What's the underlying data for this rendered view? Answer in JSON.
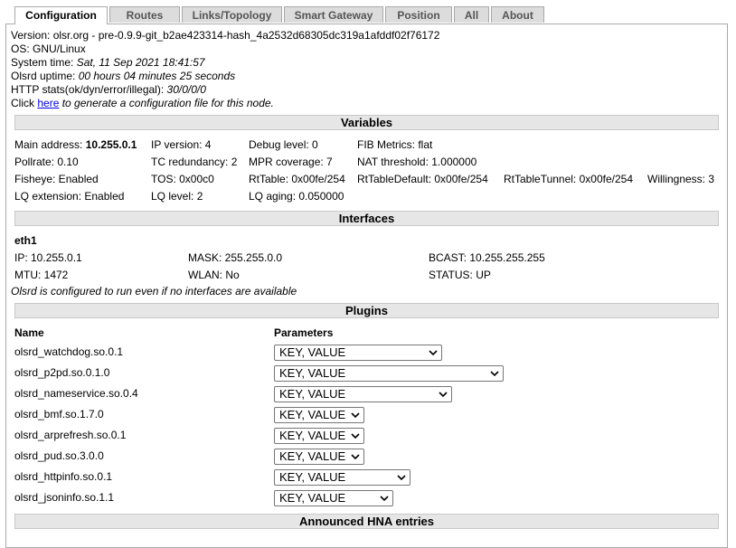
{
  "tabs": [
    {
      "label": "Configuration"
    },
    {
      "label": "Routes"
    },
    {
      "label": "Links/Topology"
    },
    {
      "label": "Smart Gateway"
    },
    {
      "label": "Position"
    },
    {
      "label": "All"
    },
    {
      "label": "About"
    }
  ],
  "info": {
    "version_label": "Version:",
    "version_value": "olsr.org - pre-0.9.9-git_b2ae423314-hash_4a2532d68305dc319a1afddf02f76172",
    "os_label": "OS:",
    "os_value": "GNU/Linux",
    "systime_label": "System time:",
    "systime_value": "Sat, 11 Sep 2021 18:41:57",
    "uptime_label": "Olsrd uptime:",
    "uptime_value": "00 hours 04 minutes 25 seconds",
    "http_label": "HTTP stats(ok/dyn/error/illegal):",
    "http_value": "30/0/0/0",
    "click_pre": "Click",
    "click_link": "here",
    "click_post": "to generate a configuration file for this node."
  },
  "variables": {
    "title": "Variables",
    "main_address_label": "Main address:",
    "main_address_value": "10.255.0.1",
    "ip_version": "IP version: 4",
    "debug_level": "Debug level: 0",
    "fib_metrics": "FIB Metrics: flat",
    "pollrate": "Pollrate: 0.10",
    "tc_redundancy": "TC redundancy: 2",
    "mpr_coverage": "MPR coverage: 7",
    "nat_threshold": "NAT threshold: 1.000000",
    "fisheye": "Fisheye: Enabled",
    "tos": "TOS: 0x00c0",
    "rttable": "RtTable: 0x00fe/254",
    "rttable_default": "RtTableDefault: 0x00fe/254",
    "rttable_tunnel": "RtTableTunnel: 0x00fe/254",
    "willingness": "Willingness: 3",
    "lq_extension": "LQ extension: Enabled",
    "lq_level": "LQ level: 2",
    "lq_aging": "LQ aging: 0.050000"
  },
  "interfaces": {
    "title": "Interfaces",
    "name": "eth1",
    "ip": "IP: 10.255.0.1",
    "mask": "MASK: 255.255.0.0",
    "bcast": "BCAST: 10.255.255.255",
    "mtu": "MTU: 1472",
    "wlan": "WLAN: No",
    "status": "STATUS: UP",
    "note": "Olsrd is configured to run even if no interfaces are available"
  },
  "plugins": {
    "title": "Plugins",
    "col_name": "Name",
    "col_params": "Parameters",
    "rows": [
      {
        "name": "olsrd_watchdog.so.0.1",
        "param": "KEY, VALUE"
      },
      {
        "name": "olsrd_p2pd.so.0.1.0",
        "param": "KEY, VALUE"
      },
      {
        "name": "olsrd_nameservice.so.0.4",
        "param": "KEY, VALUE"
      },
      {
        "name": "olsrd_bmf.so.1.7.0",
        "param": "KEY, VALUE"
      },
      {
        "name": "olsrd_arprefresh.so.0.1",
        "param": "KEY, VALUE"
      },
      {
        "name": "olsrd_pud.so.3.0.0",
        "param": "KEY, VALUE"
      },
      {
        "name": "olsrd_httpinfo.so.0.1",
        "param": "KEY, VALUE"
      },
      {
        "name": "olsrd_jsoninfo.so.1.1",
        "param": "KEY, VALUE"
      }
    ]
  },
  "hna": {
    "title": "Announced HNA entries"
  }
}
